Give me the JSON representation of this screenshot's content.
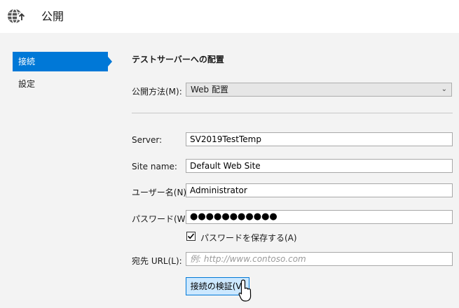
{
  "header": {
    "title": "公開",
    "icon": "globe-upload-icon"
  },
  "nav": {
    "items": [
      {
        "label": "接続",
        "active": true
      },
      {
        "label": "設定",
        "active": false
      }
    ]
  },
  "main": {
    "section_title": "テストサーバーへの配置",
    "publish_method": {
      "label": "公開方法(M):",
      "value": "Web 配置"
    },
    "server": {
      "label": "Server:",
      "value": "SV2019TestTemp"
    },
    "site_name": {
      "label": "Site name:",
      "value": "Default Web Site"
    },
    "user_name": {
      "label": "ユーザー名(N):",
      "value": "Administrator"
    },
    "password": {
      "label": "パスワード(W):",
      "value": "●●●●●●●●●●●"
    },
    "save_password": {
      "label": "パスワードを保存する(A)",
      "checked": true
    },
    "destination_url": {
      "label": "宛先 URL(L):",
      "placeholder": "例: http://www.contoso.com"
    },
    "validate_button": {
      "label": "接続の検証(V)"
    }
  },
  "colors": {
    "accent": "#0078d7",
    "button_bg": "#cce8ff"
  }
}
